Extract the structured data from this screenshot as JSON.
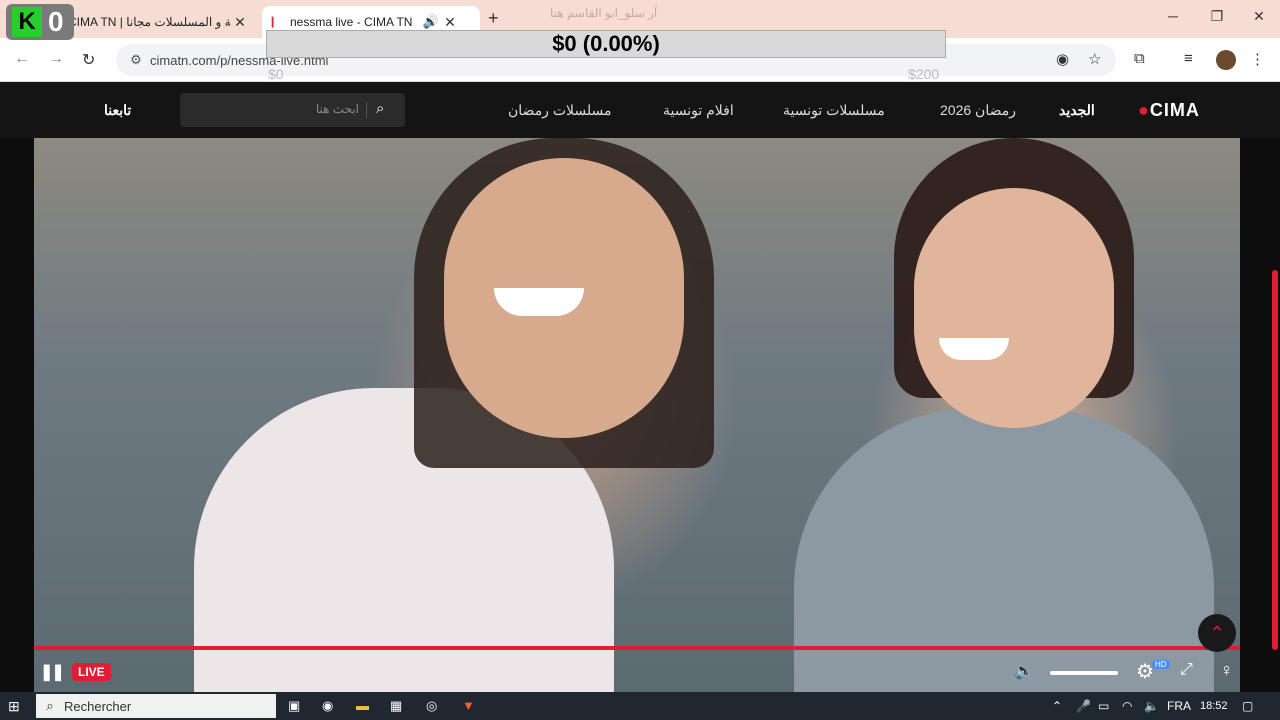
{
  "overlay": {
    "badge_letter": "K",
    "badge_count": "0",
    "price_text": "$0 (0.00%)",
    "min_label": "$0",
    "max_label": "$200"
  },
  "tabs": [
    {
      "title": "CIMA TN | ية و المسلسلات مجانا"
    },
    {
      "title": "nessma live - CIMA TN"
    }
  ],
  "faded_title": "آر سلو_ابو القاسم هنا",
  "address": {
    "url": "cimatn.com/p/nessma-live.html"
  },
  "site": {
    "logo": "CIMA",
    "nav": [
      "الجديد",
      "رمضان 2026",
      "مسلسلات تونسية",
      "افلام تونسية",
      "مسلسلات رمضان"
    ],
    "search_placeholder": "ابحث هنا",
    "follow": "تابعنا"
  },
  "player": {
    "live_label": "LIVE",
    "hd_badge": "HD",
    "progress": 1.0,
    "volume": 1.0
  },
  "taskbar": {
    "search_label": "Rechercher",
    "lang": "FRA",
    "time": "18:52"
  }
}
